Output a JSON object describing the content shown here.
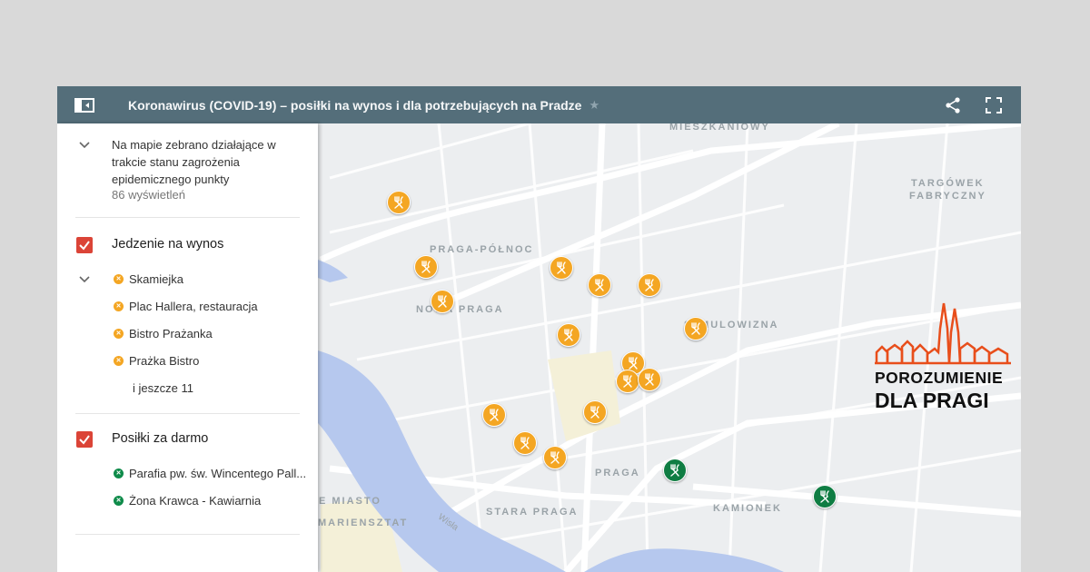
{
  "header": {
    "title": "Koronawirus (COVID-19) – posiłki na wynos i dla potrzebujących na Pradze",
    "star_icon": "star-icon",
    "share_icon": "share-icon",
    "fullscreen_icon": "fullscreen-icon",
    "panel_icon": "side-panel-icon"
  },
  "sidebar": {
    "description": "Na mapie zebrano działające w trakcie stanu zagrożenia epidemicznego punkty",
    "views": "86 wyświetleń",
    "layers": [
      {
        "title": "Jedzenie na wynos",
        "items": [
          "Skamiejka",
          "Plac Hallera, restauracja",
          "Bistro Prażanka",
          "Prażka Bistro"
        ],
        "more": "i jeszcze 11"
      },
      {
        "title": "Posiłki za darmo",
        "items": [
          "Parafia pw. św. Wincentego Pall...",
          "Żona Krawca - Kawiarnia"
        ]
      }
    ]
  },
  "map": {
    "labels": {
      "mieszkaniowy": "MIESZKANIOWY",
      "targowek1": "TARGÓWEK",
      "targowek2": "FABRYCZNY",
      "praga_polnoc": "PRAGA-PÓŁNOC",
      "nowa_praga": "NOWA PRAGA",
      "szmulowizna": "SZMULOWIZNA",
      "praga": "PRAGA",
      "kamionek": "KAMIONEK",
      "stare_miasto": "E MIASTO",
      "mariensztat": "MARIENSZTAT",
      "stara_praga": "STARA PRAGA",
      "wisla": "Wisła"
    },
    "marker_colors": {
      "takeaway": "#f4a623",
      "free": "#0f7d43"
    },
    "marker_icon": "fork-knife-icon"
  },
  "logo": {
    "line1": "POROZUMIENIE",
    "line2": "DLA PRAGI",
    "accent": "#e84e1b"
  }
}
